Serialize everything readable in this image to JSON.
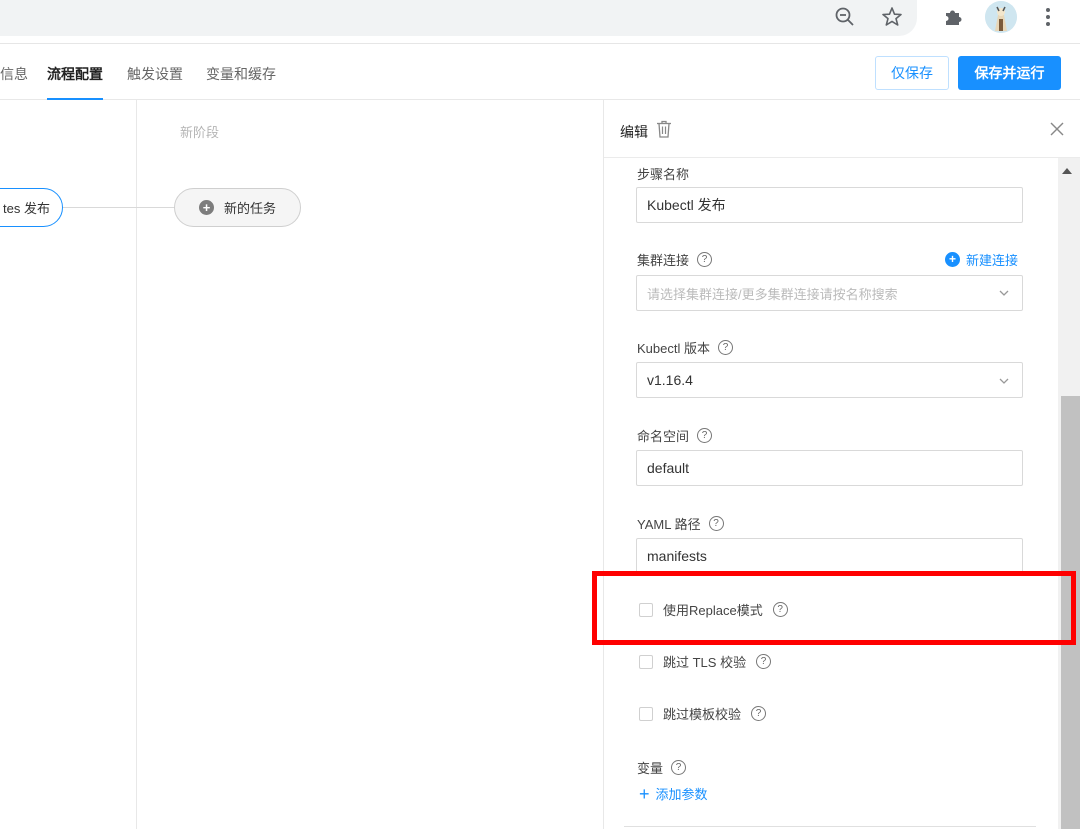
{
  "tabs": [
    {
      "label": "信息"
    },
    {
      "label": "流程配置"
    },
    {
      "label": "触发设置"
    },
    {
      "label": "变量和缓存"
    }
  ],
  "actions": {
    "save_only": "仅保存",
    "save_and_run": "保存并运行"
  },
  "canvas": {
    "stage_label": "新阶段",
    "job_node_label": "tes 发布",
    "new_task_label": "新的任务"
  },
  "panel": {
    "title": "编辑",
    "fields": {
      "step_name": {
        "label": "步骤名称",
        "value": "Kubectl 发布"
      },
      "cluster": {
        "label": "集群连接",
        "placeholder": "请选择集群连接/更多集群连接请按名称搜索",
        "new_link": "新建连接"
      },
      "kubectl_version": {
        "label": "Kubectl 版本",
        "value": "v1.16.4"
      },
      "namespace": {
        "label": "命名空间",
        "value": "default"
      },
      "yaml_path": {
        "label": "YAML 路径",
        "value": "manifests"
      }
    },
    "checkboxes": [
      {
        "label": "使用Replace模式",
        "checked": false
      },
      {
        "label": "跳过 TLS 校验",
        "checked": false
      },
      {
        "label": "跳过模板校验",
        "checked": false
      }
    ],
    "variables": {
      "label": "变量",
      "add_label": "添加参数"
    }
  },
  "icons": {
    "help": "?",
    "accent": "#1890ff",
    "highlight_color": "#ff0000"
  }
}
